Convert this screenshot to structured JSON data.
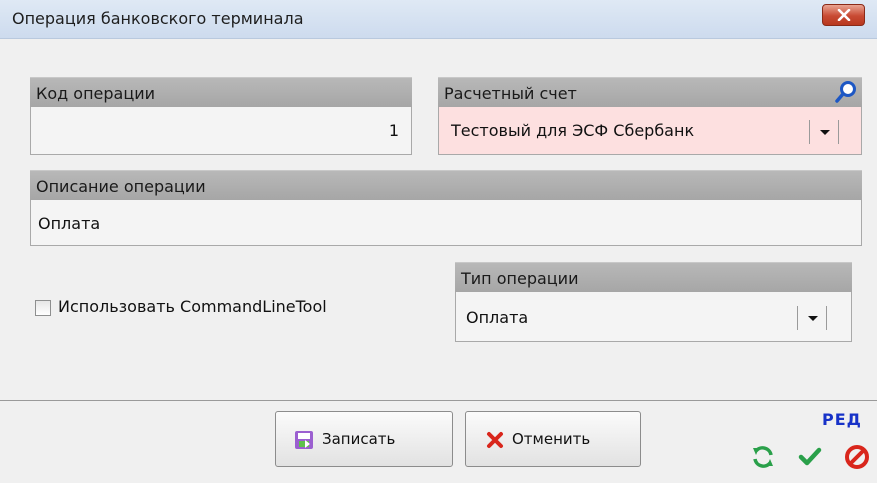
{
  "window": {
    "title": "Операция банковского терминала",
    "close_icon": "close-icon"
  },
  "operation_code": {
    "label": "Код операции",
    "value": "1"
  },
  "account": {
    "label": "Расчетный счет",
    "value": "Тестовый для ЭСФ Сбербанк",
    "search_icon": "search-icon",
    "highlight_color": "#fde0e0"
  },
  "description": {
    "label": "Описание операции",
    "value": "Оплата"
  },
  "command_line_tool": {
    "label": "Использовать CommandLineTool",
    "checked": false
  },
  "operation_type": {
    "label": "Тип операции",
    "value": "Оплата"
  },
  "buttons": {
    "save_label": "Записать",
    "cancel_label": "Отменить"
  },
  "status": {
    "mode_label": "РЕД",
    "icons": [
      "refresh-icon",
      "check-icon",
      "forbidden-icon"
    ]
  }
}
